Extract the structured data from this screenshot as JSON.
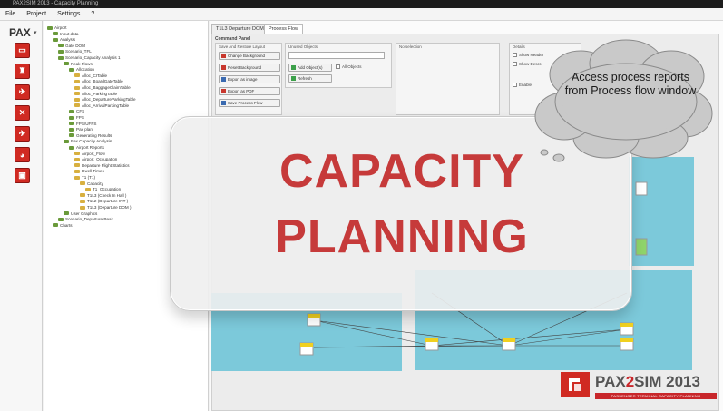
{
  "window": {
    "title": "PAX2SIM 2013 - Capacity Planning"
  },
  "menu": {
    "items": [
      "File",
      "Project",
      "Settings",
      "?"
    ]
  },
  "pax_panel": {
    "title": "PAX",
    "icons": [
      "home-icon",
      "passenger-icon",
      "aircraft-icon",
      "baggage-icon",
      "chart-icon",
      "report-icon",
      "export-icon"
    ]
  },
  "tree": {
    "items": [
      {
        "label": "Airport",
        "indent": 0
      },
      {
        "label": "Input data",
        "indent": 1
      },
      {
        "label": "Analysis",
        "indent": 1
      },
      {
        "label": "Gate DOM",
        "indent": 2
      },
      {
        "label": "Scenario_TFL",
        "indent": 2
      },
      {
        "label": "Scenario_Capacity Analysis 1",
        "indent": 2
      },
      {
        "label": "Peak Flows",
        "indent": 3
      },
      {
        "label": "Allocation",
        "indent": 4
      },
      {
        "label": "Alloc_CITable",
        "indent": 5
      },
      {
        "label": "Alloc_BoardGateTable",
        "indent": 5
      },
      {
        "label": "Alloc_BaggageClaimTable",
        "indent": 5
      },
      {
        "label": "Alloc_ParkingTable",
        "indent": 5
      },
      {
        "label": "Alloc_DepartureParkingTable",
        "indent": 5
      },
      {
        "label": "Alloc_ArrivalParkingTable",
        "indent": 5
      },
      {
        "label": "CFS",
        "indent": 4
      },
      {
        "label": "FPS",
        "indent": 4
      },
      {
        "label": "FPS/UFPS",
        "indent": 4
      },
      {
        "label": "Pax plan",
        "indent": 4
      },
      {
        "label": "Generating Results",
        "indent": 4
      },
      {
        "label": "Pax Capacity Analysis",
        "indent": 3
      },
      {
        "label": "Airport Reports",
        "indent": 4
      },
      {
        "label": "Airport_Flow",
        "indent": 5
      },
      {
        "label": "Airport_Occupation",
        "indent": 5
      },
      {
        "label": "Departure Flight Statistics",
        "indent": 5
      },
      {
        "label": "Dwell Times",
        "indent": 5
      },
      {
        "label": "T1 (T1)",
        "indent": 5
      },
      {
        "label": "Capacity",
        "indent": 6
      },
      {
        "label": "T1_Occupation",
        "indent": 7
      },
      {
        "label": "T1L3 (Check In Hall )",
        "indent": 6
      },
      {
        "label": "T1L2 (Departure INT )",
        "indent": 6
      },
      {
        "label": "T1L3 (Departure DOM )",
        "indent": 6
      },
      {
        "label": "User Graphics",
        "indent": 3
      },
      {
        "label": "Scenario_Departure Peak",
        "indent": 2
      },
      {
        "label": "Charts",
        "indent": 1
      }
    ]
  },
  "tabs": [
    {
      "label": "T1L3 Departure DOM"
    },
    {
      "label": "Process Flow"
    }
  ],
  "process_flow": {
    "header": "Command Panel",
    "group_buttons_label": "Save And Restore Layout",
    "buttons": [
      {
        "label": "Change Background",
        "icon": "image-icon"
      },
      {
        "label": "Reset Background",
        "icon": "image-icon"
      },
      {
        "label": "Export as image",
        "icon": "export-icon"
      },
      {
        "label": "Export as PDF",
        "icon": "pdf-icon"
      },
      {
        "label": "Save Process Flow",
        "icon": "save-icon"
      }
    ],
    "unused_label": "Unused Objects",
    "add_label": "Add Object(s)",
    "refresh_label": "Refresh",
    "all_objects_label": "All Objects",
    "selection_label": "No selection",
    "details_label": "Details",
    "show_checks": [
      "Show Header",
      "Show Descr.",
      "Enable"
    ]
  },
  "banner": {
    "line1": "CAPACITY",
    "line2": "PLANNING"
  },
  "callout": {
    "text": "Access process reports from Process flow window"
  },
  "logo": {
    "name_dark": "PAX",
    "name_red": "2",
    "name_dark2": "SIM 2013",
    "tagline": "PASSENGER TERMINAL CAPACITY PLANNING"
  },
  "colors": {
    "accent_red": "#c63a3a",
    "flow_blue": "#7cc9da",
    "icon_red": "#d02a22"
  }
}
